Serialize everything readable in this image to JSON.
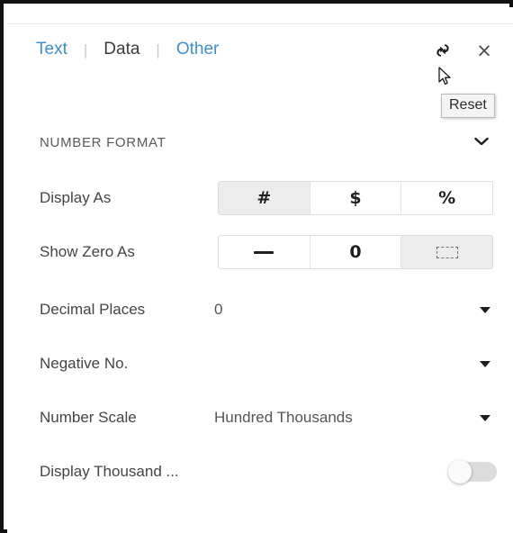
{
  "panel": {
    "tabs": [
      {
        "label": "Text",
        "active": false
      },
      {
        "label": "Data",
        "active": true
      },
      {
        "label": "Other",
        "active": false
      }
    ],
    "separator": "|",
    "reset_icon": "reset-icon",
    "close_label": "×",
    "tooltip": "Reset",
    "accent_color": "#3c8fd4",
    "active_tab_color": "#3b3b3b"
  },
  "section": {
    "title": "NUMBER FORMAT",
    "collapse_icon": "chevron-down-icon"
  },
  "rows": {
    "display_as": {
      "label": "Display As",
      "options": [
        {
          "label": "#",
          "selected": true
        },
        {
          "label": "$",
          "selected": false
        },
        {
          "label": "%",
          "selected": false
        }
      ]
    },
    "show_zero_as": {
      "label": "Show Zero As",
      "options": [
        {
          "label": "—",
          "selected": false
        },
        {
          "label": "0",
          "selected": false
        },
        {
          "label": "",
          "selected": true
        }
      ]
    },
    "decimal_places": {
      "label": "Decimal Places",
      "value": "0"
    },
    "negative_no": {
      "label": "Negative No.",
      "value": ""
    },
    "number_scale": {
      "label": "Number Scale",
      "value": "Hundred Thousands"
    },
    "display_thousand": {
      "label": "Display Thousand ...",
      "toggle_state": "off"
    }
  }
}
